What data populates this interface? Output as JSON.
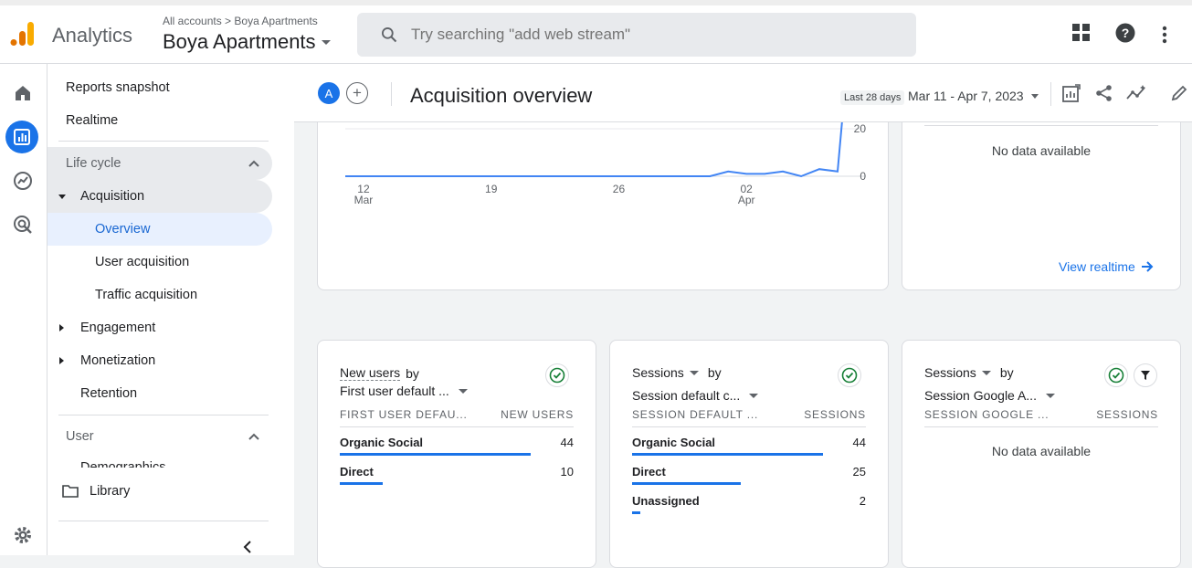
{
  "app": {
    "brand": "Analytics",
    "crumb_all": "All accounts",
    "crumb_sep": ">",
    "crumb_account": "Boya Apartments",
    "property": "Boya Apartments",
    "search_placeholder": "Try searching \"add web stream\""
  },
  "nav": {
    "reports_snapshot": "Reports snapshot",
    "realtime": "Realtime",
    "lifecycle": "Life cycle",
    "acquisition": "Acquisition",
    "overview": "Overview",
    "user_acquisition": "User acquisition",
    "traffic_acquisition": "Traffic acquisition",
    "engagement": "Engagement",
    "monetization": "Monetization",
    "retention": "Retention",
    "user_section": "User",
    "demographics_partial": "Demographics",
    "library": "Library"
  },
  "header": {
    "avatar": "A",
    "title": "Acquisition overview",
    "date_label": "Last 28 days",
    "date_range": "Mar 11 - Apr 7, 2023"
  },
  "chart_data": {
    "type": "line",
    "x": [
      "Mar 11",
      "Mar 12",
      "Mar 13",
      "Mar 14",
      "Mar 15",
      "Mar 16",
      "Mar 17",
      "Mar 18",
      "Mar 19",
      "Mar 20",
      "Mar 21",
      "Mar 22",
      "Mar 23",
      "Mar 24",
      "Mar 25",
      "Mar 26",
      "Mar 27",
      "Mar 28",
      "Mar 29",
      "Mar 30",
      "Mar 31",
      "Apr 1",
      "Apr 2",
      "Apr 3",
      "Apr 4",
      "Apr 5",
      "Apr 6",
      "Apr 7"
    ],
    "values": [
      0,
      0,
      0,
      0,
      0,
      0,
      0,
      0,
      0,
      0,
      0,
      0,
      0,
      0,
      0,
      0,
      0,
      0,
      0,
      0,
      0,
      2,
      1,
      1,
      2,
      0,
      3,
      2
    ],
    "tail_value": 45,
    "xticks": [
      {
        "label": "12",
        "sub": "Mar",
        "x": "Mar 12"
      },
      {
        "label": "19",
        "sub": "",
        "x": "Mar 19"
      },
      {
        "label": "26",
        "sub": "",
        "x": "Mar 26"
      },
      {
        "label": "02",
        "sub": "Apr",
        "x": "Apr 2"
      }
    ],
    "yticks": [
      "20",
      "0"
    ],
    "color": "#4285f4"
  },
  "realtime_card": {
    "no_data": "No data available",
    "view_link": "View realtime"
  },
  "card1": {
    "title_metric": "New users",
    "title_by": "by",
    "dimension": "First user default ...",
    "col1": "FIRST USER DEFAU...",
    "col2": "NEW USERS",
    "rows": [
      {
        "label": "Organic Social",
        "value": "44",
        "pct": 1.0
      },
      {
        "label": "Direct",
        "value": "10",
        "pct": 0.227
      }
    ]
  },
  "card2": {
    "title_metric": "Sessions",
    "title_by": "by",
    "dimension": "Session default c...",
    "col1": "SESSION DEFAULT ...",
    "col2": "SESSIONS",
    "rows": [
      {
        "label": "Organic Social",
        "value": "44",
        "pct": 1.0
      },
      {
        "label": "Direct",
        "value": "25",
        "pct": 0.568
      },
      {
        "label": "Unassigned",
        "value": "2",
        "pct": 0.045
      }
    ]
  },
  "card3": {
    "title_metric": "Sessions",
    "title_by": "by",
    "dimension": "Session Google A...",
    "col1": "SESSION GOOGLE ...",
    "col2": "SESSIONS",
    "no_data": "No data available"
  },
  "colors": {
    "accent": "#1a73e8",
    "success": "#188038"
  }
}
